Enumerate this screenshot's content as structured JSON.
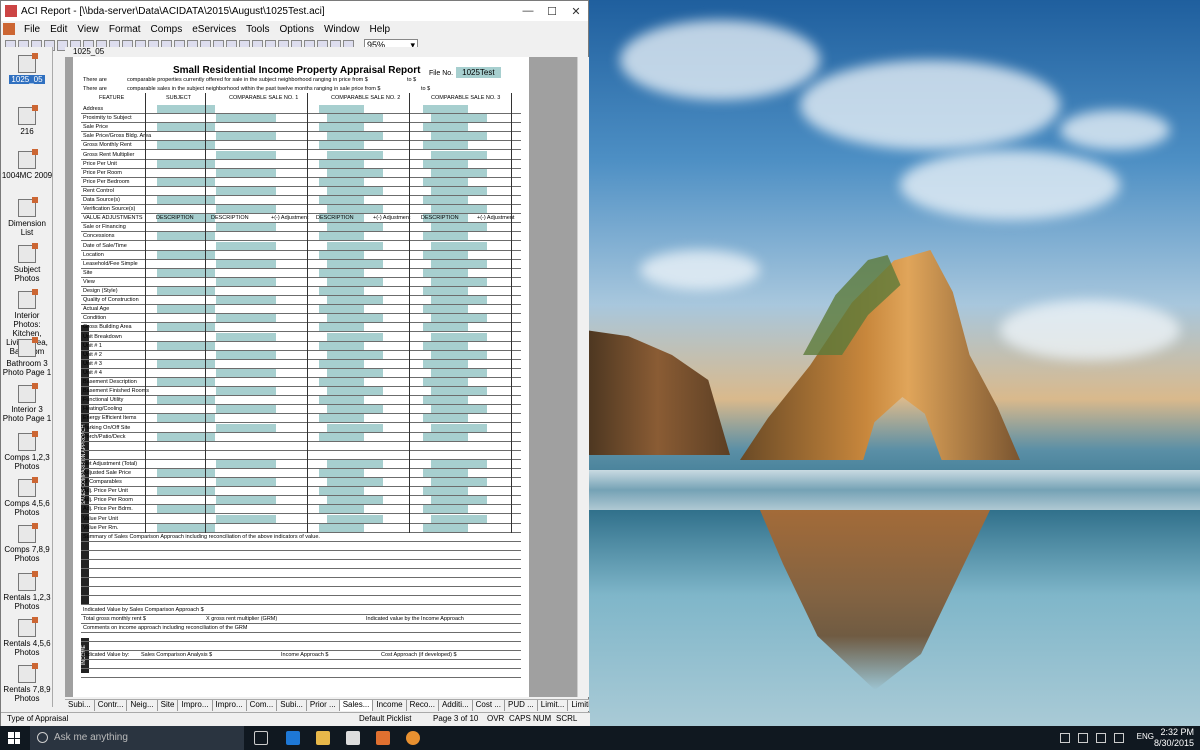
{
  "window": {
    "title": "ACI Report - [\\\\bda-server\\Data\\ACIDATA\\2015\\August\\1025Test.aci]",
    "min": "—",
    "max": "☐",
    "close": "✕"
  },
  "menu": [
    "File",
    "Edit",
    "View",
    "Format",
    "Comps",
    "eServices",
    "Tools",
    "Options",
    "Window",
    "Help"
  ],
  "zoom": "95%",
  "doc_tab": "1025_05",
  "sidebar": [
    "1025_05",
    "216",
    "1004MC 2009",
    "Dimension List",
    "Subject Photos",
    "Interior Photos: Kitchen, Living Area, Bathroom",
    "Bathroom 3 Photo Page 1",
    "Interior 3 Photo Page 1",
    "Comps 1,2,3 Photos",
    "Comps 4,5,6 Photos",
    "Comps 7,8,9 Photos",
    "Rentals 1,2,3 Photos",
    "Rentals 4,5,6 Photos",
    "Rentals 7,8,9 Photos"
  ],
  "form": {
    "title": "Small Residential Income Property Appraisal Report",
    "file_no_label": "File No.",
    "file_no": "1025Test",
    "intro1": "comparable properties currently offered for sale in the subject neighborhood ranging in price from $",
    "intro2": "comparable sales in the subject neighborhood within the past twelve months ranging in sale price from $",
    "there_are": "There are",
    "to": "to $",
    "headers": [
      "FEATURE",
      "SUBJECT",
      "COMPARABLE SALE NO. 1",
      "COMPARABLE SALE NO. 2",
      "COMPARABLE SALE NO. 3"
    ],
    "side_label": "SALES COMPARISON APPROACH",
    "income_label": "INCOME",
    "rows": [
      "Address",
      "Proximity to Subject",
      "Sale Price",
      "Sale Price/Gross Bldg. Area",
      "Gross Monthly Rent",
      "Gross Rent Multiplier",
      "Price Per Unit",
      "Price Per Room",
      "Price Per Bedroom",
      "Rent Control",
      "Data Source(s)",
      "Verification Source(s)",
      "VALUE ADJUSTMENTS",
      "Sale or Financing",
      "Concessions",
      "Date of Sale/Time",
      "Location",
      "Leasehold/Fee Simple",
      "Site",
      "View",
      "Design (Style)",
      "Quality of Construction",
      "Actual Age",
      "Condition",
      "Gross Building Area",
      "Unit Breakdown",
      "Unit # 1",
      "Unit # 2",
      "Unit # 3",
      "Unit # 4",
      "Basement Description",
      "Basement Finished Rooms",
      "Functional Utility",
      "Heating/Cooling",
      "Energy Efficient Items",
      "Parking On/Off Site",
      "Porch/Patio/Deck",
      "",
      "",
      "Net Adjustment (Total)",
      "Adjusted Sale Price",
      "of Comparables",
      "Adj. Price Per Unit",
      "Adj. Price Per Room",
      "Adj. Price Per Bdrm.",
      "Value Per Unit",
      "Value Per Rm.",
      "Summary of Sales Comparison Approach including reconciliation of the above indicators of value.",
      "",
      "",
      "",
      "",
      "",
      "",
      "",
      "Indicated Value by Sales Comparison Approach $",
      "Total gross monthly rent $",
      "Comments on income approach including reconciliation of the GRM",
      "",
      "",
      "Indicated Value by:",
      "",
      ""
    ],
    "desc_headers": [
      "DESCRIPTION",
      "DESCRIPTION",
      "+(-) Adjustment",
      "DESCRIPTION",
      "+(-) Adjustment",
      "DESCRIPTION",
      "+(-) Adjustment"
    ],
    "grm_text": "X gross rent multiplier (GRM)",
    "income_text": "Indicated value by the Income Approach",
    "ind_sales": "Sales Comparison Analysis $",
    "ind_income": "Income Approach $",
    "ind_cost": "Cost Approach (if developed) $"
  },
  "tabs": [
    "Subi...",
    "Contr...",
    "Neig...",
    "Site",
    "Impro...",
    "Impro...",
    "Com...",
    "Subi...",
    "Prior ...",
    "Sales...",
    "Income",
    "Reco...",
    "Additi...",
    "Cost ...",
    "PUD ...",
    "Limit...",
    "Limiti..."
  ],
  "status": {
    "field": "Type of Appraisal",
    "picklist": "Default Picklist",
    "page": "Page 3 of 10",
    "ovr": "OVR",
    "caps": "CAPS",
    "num": "NUM",
    "scrl": "SCRL"
  },
  "taskbar": {
    "search_placeholder": "Ask me anything",
    "lang": "ENG",
    "time": "2:32 PM",
    "date": "8/30/2015"
  }
}
